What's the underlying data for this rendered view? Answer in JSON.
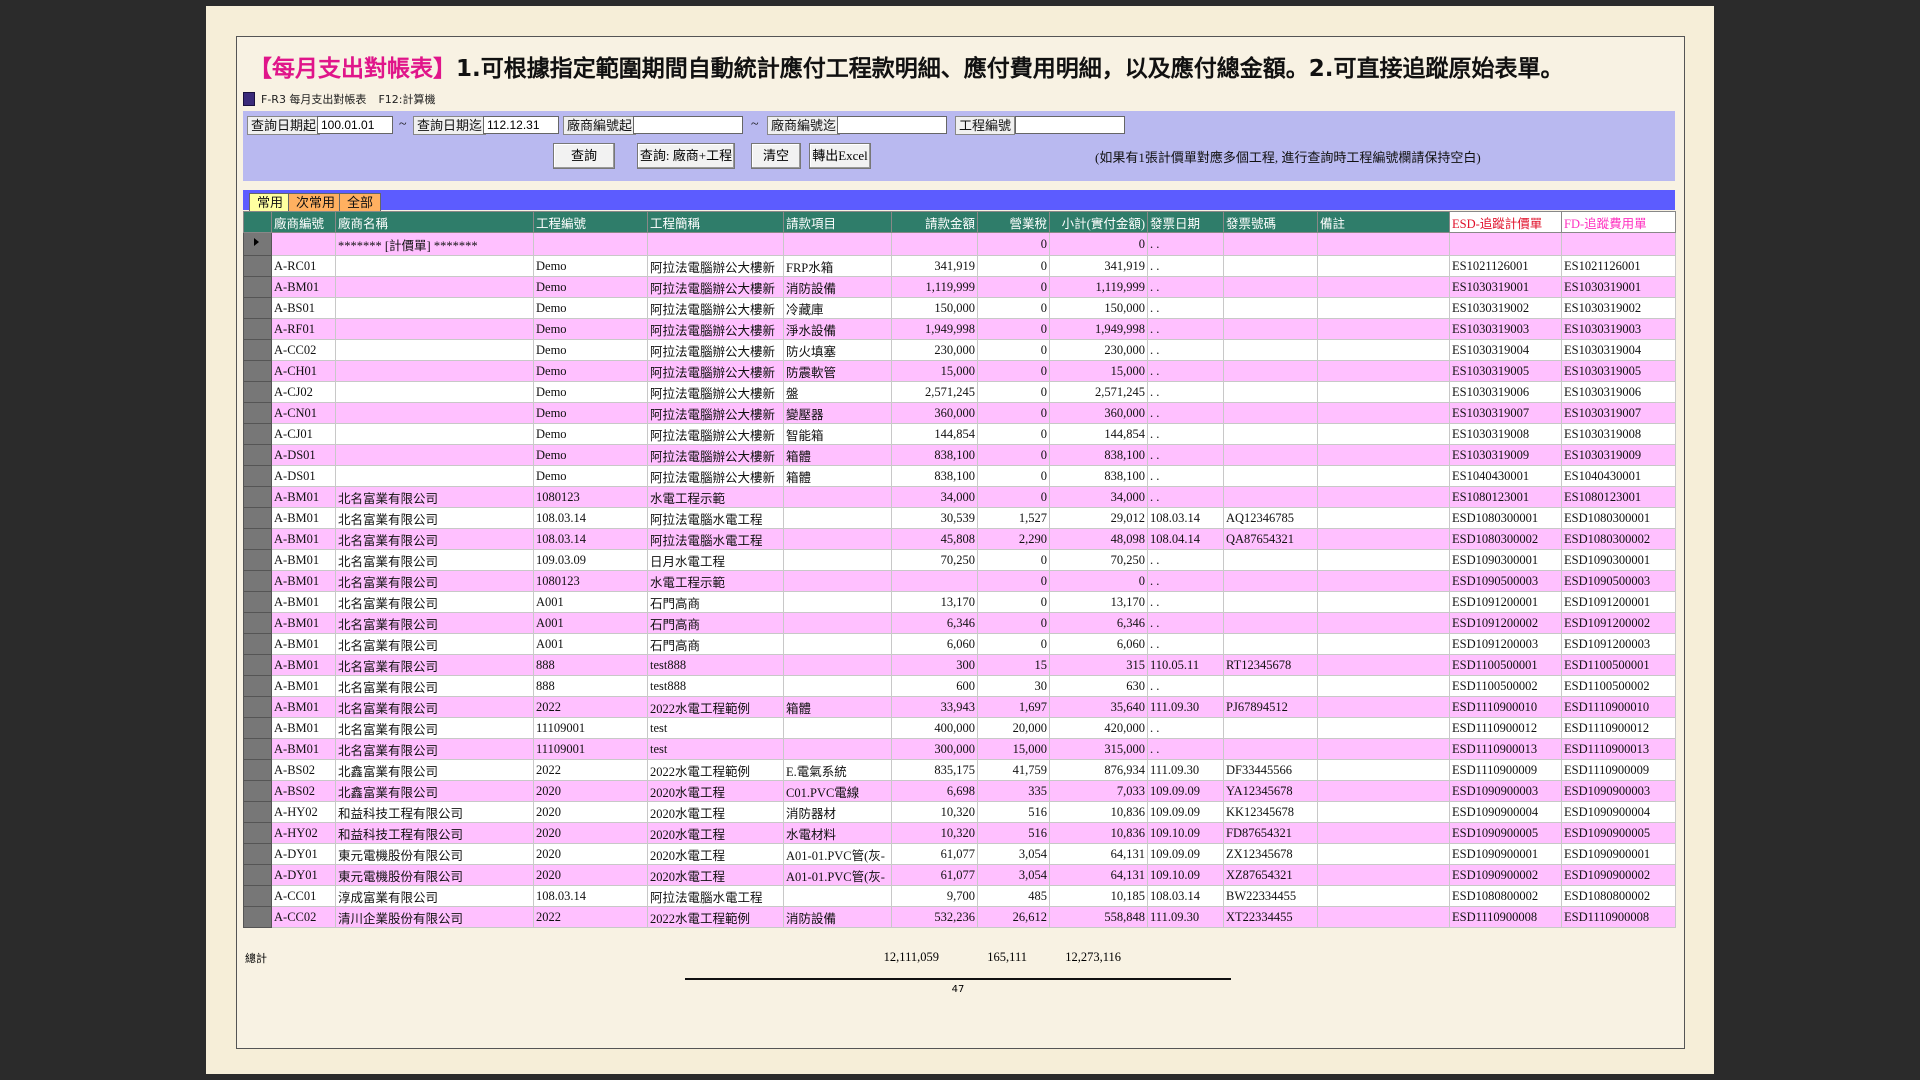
{
  "headline": {
    "tag": "【每月支出對帳表】",
    "text": "1.可根據指定範圍期間自動統計應付工程款明細、應付費用明細，以及應付總金額。2.可直接追蹤原始表單。"
  },
  "window": {
    "title": "F-R3 每月支出對帳表",
    "hint": "F12:計算機"
  },
  "filters": {
    "date_from_label": "查詢日期起",
    "date_from": "100.01.01",
    "date_to_label": "查詢日期迄",
    "date_to": "112.12.31",
    "vendor_from_label": "廠商編號起",
    "vendor_from": "",
    "vendor_to_label": "廠商編號迄",
    "vendor_to": "",
    "project_label": "工程編號",
    "project": "",
    "tilde": "~"
  },
  "buttons": {
    "query": "查詢",
    "query_vendor_project": "查詢: 廠商+工程",
    "clear": "清空",
    "export": "轉出Excel"
  },
  "note": "(如果有1張計價單對應多個工程, 進行查詢時工程編號欄請保持空白)",
  "tabs": [
    "常用",
    "次常用",
    "全部"
  ],
  "columns": [
    "廠商編號",
    "廠商名稱",
    "工程編號",
    "工程簡稱",
    "請款項目",
    "請款金額",
    "營業稅",
    "小計(實付金額)",
    "發票日期",
    "發票號碼",
    "備註",
    "ESD-追蹤計價單",
    "FD-追蹤費用單"
  ],
  "rows": [
    [
      "",
      "******* [計價單] *******",
      "",
      "",
      "",
      "",
      "0",
      "0",
      ". .",
      "",
      "",
      "",
      ""
    ],
    [
      "A-RC01",
      "",
      "Demo",
      "阿拉法電腦辦公大樓新",
      "FRP水箱",
      "341,919",
      "0",
      "341,919",
      ". .",
      "",
      "",
      "ES1021126001",
      "ES1021126001"
    ],
    [
      "A-BM01",
      "",
      "Demo",
      "阿拉法電腦辦公大樓新",
      "消防設備",
      "1,119,999",
      "0",
      "1,119,999",
      ". .",
      "",
      "",
      "ES1030319001",
      "ES1030319001"
    ],
    [
      "A-BS01",
      "",
      "Demo",
      "阿拉法電腦辦公大樓新",
      "冷藏庫",
      "150,000",
      "0",
      "150,000",
      ". .",
      "",
      "",
      "ES1030319002",
      "ES1030319002"
    ],
    [
      "A-RF01",
      "",
      "Demo",
      "阿拉法電腦辦公大樓新",
      "淨水設備",
      "1,949,998",
      "0",
      "1,949,998",
      ". .",
      "",
      "",
      "ES1030319003",
      "ES1030319003"
    ],
    [
      "A-CC02",
      "",
      "Demo",
      "阿拉法電腦辦公大樓新",
      "防火填塞",
      "230,000",
      "0",
      "230,000",
      ". .",
      "",
      "",
      "ES1030319004",
      "ES1030319004"
    ],
    [
      "A-CH01",
      "",
      "Demo",
      "阿拉法電腦辦公大樓新",
      "防震軟管",
      "15,000",
      "0",
      "15,000",
      ". .",
      "",
      "",
      "ES1030319005",
      "ES1030319005"
    ],
    [
      "A-CJ02",
      "",
      "Demo",
      "阿拉法電腦辦公大樓新",
      "盤",
      "2,571,245",
      "0",
      "2,571,245",
      ". .",
      "",
      "",
      "ES1030319006",
      "ES1030319006"
    ],
    [
      "A-CN01",
      "",
      "Demo",
      "阿拉法電腦辦公大樓新",
      "變壓器",
      "360,000",
      "0",
      "360,000",
      ". .",
      "",
      "",
      "ES1030319007",
      "ES1030319007"
    ],
    [
      "A-CJ01",
      "",
      "Demo",
      "阿拉法電腦辦公大樓新",
      "智能箱",
      "144,854",
      "0",
      "144,854",
      ". .",
      "",
      "",
      "ES1030319008",
      "ES1030319008"
    ],
    [
      "A-DS01",
      "",
      "Demo",
      "阿拉法電腦辦公大樓新",
      "箱體",
      "838,100",
      "0",
      "838,100",
      ". .",
      "",
      "",
      "ES1030319009",
      "ES1030319009"
    ],
    [
      "A-DS01",
      "",
      "Demo",
      "阿拉法電腦辦公大樓新",
      "箱體",
      "838,100",
      "0",
      "838,100",
      ". .",
      "",
      "",
      "ES1040430001",
      "ES1040430001"
    ],
    [
      "A-BM01",
      "北名富業有限公司",
      "1080123",
      "水電工程示範",
      "",
      "34,000",
      "0",
      "34,000",
      ". .",
      "",
      "",
      "ES1080123001",
      "ES1080123001"
    ],
    [
      "A-BM01",
      "北名富業有限公司",
      "108.03.14",
      "阿拉法電腦水電工程",
      "",
      "30,539",
      "1,527",
      "29,012",
      "108.03.14",
      "AQ12346785",
      "",
      "ESD1080300001",
      "ESD1080300001"
    ],
    [
      "A-BM01",
      "北名富業有限公司",
      "108.03.14",
      "阿拉法電腦水電工程",
      "",
      "45,808",
      "2,290",
      "48,098",
      "108.04.14",
      "QA87654321",
      "",
      "ESD1080300002",
      "ESD1080300002"
    ],
    [
      "A-BM01",
      "北名富業有限公司",
      "109.03.09",
      "日月水電工程",
      "",
      "70,250",
      "0",
      "70,250",
      ". .",
      "",
      "",
      "ESD1090300001",
      "ESD1090300001"
    ],
    [
      "A-BM01",
      "北名富業有限公司",
      "1080123",
      "水電工程示範",
      "",
      "",
      "0",
      "0",
      ". .",
      "",
      "",
      "ESD1090500003",
      "ESD1090500003"
    ],
    [
      "A-BM01",
      "北名富業有限公司",
      "A001",
      "石門高商",
      "",
      "13,170",
      "0",
      "13,170",
      ". .",
      "",
      "",
      "ESD1091200001",
      "ESD1091200001"
    ],
    [
      "A-BM01",
      "北名富業有限公司",
      "A001",
      "石門高商",
      "",
      "6,346",
      "0",
      "6,346",
      ". .",
      "",
      "",
      "ESD1091200002",
      "ESD1091200002"
    ],
    [
      "A-BM01",
      "北名富業有限公司",
      "A001",
      "石門高商",
      "",
      "6,060",
      "0",
      "6,060",
      ". .",
      "",
      "",
      "ESD1091200003",
      "ESD1091200003"
    ],
    [
      "A-BM01",
      "北名富業有限公司",
      "888",
      "test888",
      "",
      "300",
      "15",
      "315",
      "110.05.11",
      "RT12345678",
      "",
      "ESD1100500001",
      "ESD1100500001"
    ],
    [
      "A-BM01",
      "北名富業有限公司",
      "888",
      "test888",
      "",
      "600",
      "30",
      "630",
      ". .",
      "",
      "",
      "ESD1100500002",
      "ESD1100500002"
    ],
    [
      "A-BM01",
      "北名富業有限公司",
      "2022",
      "2022水電工程範例",
      "箱體",
      "33,943",
      "1,697",
      "35,640",
      "111.09.30",
      "PJ67894512",
      "",
      "ESD1110900010",
      "ESD1110900010"
    ],
    [
      "A-BM01",
      "北名富業有限公司",
      "11109001",
      "test",
      "",
      "400,000",
      "20,000",
      "420,000",
      ". .",
      "",
      "",
      "ESD1110900012",
      "ESD1110900012"
    ],
    [
      "A-BM01",
      "北名富業有限公司",
      "11109001",
      "test",
      "",
      "300,000",
      "15,000",
      "315,000",
      ". .",
      "",
      "",
      "ESD1110900013",
      "ESD1110900013"
    ],
    [
      "A-BS02",
      "北鑫富業有限公司",
      "2022",
      "2022水電工程範例",
      "E.電氣系統",
      "835,175",
      "41,759",
      "876,934",
      "111.09.30",
      "DF33445566",
      "",
      "ESD1110900009",
      "ESD1110900009"
    ],
    [
      "A-BS02",
      "北鑫富業有限公司",
      "2020",
      "2020水電工程",
      "C01.PVC電線",
      "6,698",
      "335",
      "7,033",
      "109.09.09",
      "YA12345678",
      "",
      "ESD1090900003",
      "ESD1090900003"
    ],
    [
      "A-HY02",
      "和益科技工程有限公司",
      "2020",
      "2020水電工程",
      "消防器材",
      "10,320",
      "516",
      "10,836",
      "109.09.09",
      "KK12345678",
      "",
      "ESD1090900004",
      "ESD1090900004"
    ],
    [
      "A-HY02",
      "和益科技工程有限公司",
      "2020",
      "2020水電工程",
      "水電材料",
      "10,320",
      "516",
      "10,836",
      "109.10.09",
      "FD87654321",
      "",
      "ESD1090900005",
      "ESD1090900005"
    ],
    [
      "A-DY01",
      "東元電機股份有限公司",
      "2020",
      "2020水電工程",
      "A01-01.PVC管(灰-",
      "61,077",
      "3,054",
      "64,131",
      "109.09.09",
      "ZX12345678",
      "",
      "ESD1090900001",
      "ESD1090900001"
    ],
    [
      "A-DY01",
      "東元電機股份有限公司",
      "2020",
      "2020水電工程",
      "A01-01.PVC管(灰-",
      "61,077",
      "3,054",
      "64,131",
      "109.10.09",
      "XZ87654321",
      "",
      "ESD1090900002",
      "ESD1090900002"
    ],
    [
      "A-CC01",
      "淳成富業有限公司",
      "108.03.14",
      "阿拉法電腦水電工程",
      "",
      "9,700",
      "485",
      "10,185",
      "108.03.14",
      "BW22334455",
      "",
      "ESD1080800002",
      "ESD1080800002"
    ],
    [
      "A-CC02",
      "清川企業股份有限公司",
      "2022",
      "2022水電工程範例",
      "消防設備",
      "532,236",
      "26,612",
      "558,848",
      "111.09.30",
      "XT22334455",
      "",
      "ESD1110900008",
      "ESD1110900008"
    ]
  ],
  "totals": {
    "label": "總計",
    "amount": "12,111,059",
    "tax": "165,111",
    "subtotal": "12,273,116"
  },
  "page_number": "47",
  "colors": {
    "header_bg": "#2f7d6a",
    "row_pink": "#ffc0ff",
    "toolbar_bg": "#b9b9f0",
    "tabbar_bg": "#5c5cff",
    "accent_magenta": "#e0158a"
  }
}
